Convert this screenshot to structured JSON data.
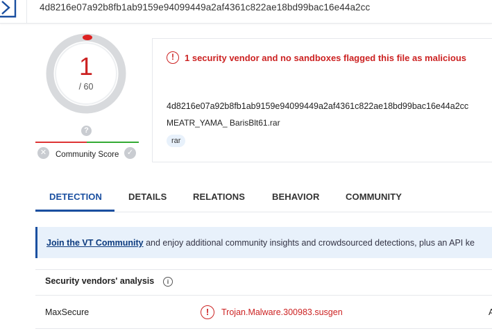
{
  "topbar": {
    "hash": "4d8216e07a92b8fb1ab9159e94099449a2af4361c822ae18bd99bac16e44a2cc"
  },
  "score": {
    "detections": "1",
    "total": "/ 60"
  },
  "community": {
    "question_mark": "?",
    "label": "Community Score",
    "x_symbol": "✕",
    "check_symbol": "✓"
  },
  "summary": {
    "alert_icon": "!",
    "alert_text": "1 security vendor and no sandboxes flagged this file as malicious",
    "hash": "4d8216e07a92b8fb1ab9159e94099449a2af4361c822ae18bd99bac16e44a2cc",
    "filename": "MEATR_YAMA_ BarisBlt61.rar",
    "tag": "rar"
  },
  "tabs": [
    {
      "label": "DETECTION",
      "active": true
    },
    {
      "label": "DETAILS",
      "active": false
    },
    {
      "label": "RELATIONS",
      "active": false
    },
    {
      "label": "BEHAVIOR",
      "active": false
    },
    {
      "label": "COMMUNITY",
      "active": false
    }
  ],
  "banner": {
    "link": "Join the VT Community",
    "text": " and enjoy additional community insights and crowdsourced detections, plus an API ke"
  },
  "vendors": {
    "title": "Security vendors' analysis",
    "info_icon": "i",
    "rows": [
      {
        "vendor": "MaxSecure",
        "icon": "!",
        "result": "Trojan.Malware.300983.susgen",
        "edge": "A"
      }
    ]
  },
  "colors": {
    "malicious": "#cc2222",
    "accent": "#1a4fa0",
    "banner_bg": "#e8f1fb"
  }
}
